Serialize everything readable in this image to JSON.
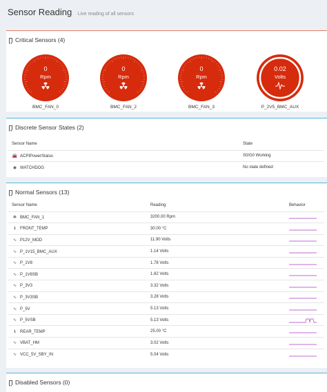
{
  "header": {
    "title": "Sensor Reading",
    "subtitle": "Live reading of all sensors"
  },
  "critical": {
    "heading": "Critical Sensors (4)",
    "gauges": [
      {
        "name": "BMC_FAN_0",
        "value": "0",
        "unit": "Rpm",
        "icon": "radiation-icon",
        "style": "filled"
      },
      {
        "name": "BMC_FAN_2",
        "value": "0",
        "unit": "Rpm",
        "icon": "radiation-icon",
        "style": "filled"
      },
      {
        "name": "BMC_FAN_3",
        "value": "0",
        "unit": "Rpm",
        "icon": "radiation-icon",
        "style": "filled"
      },
      {
        "name": "P_2V5_BMC_AUX",
        "value": "0.02",
        "unit": "Volts",
        "icon": "pulse-icon",
        "style": "ring"
      }
    ],
    "color": "#d62b0c"
  },
  "discrete": {
    "heading": "Discrete Sensor States (2)",
    "columns": [
      "Sensor Name",
      "State"
    ],
    "rows": [
      {
        "icon": "car-icon",
        "name": "ACPIPowerStatus",
        "state": "S0/G0 Working"
      },
      {
        "icon": "eye-icon",
        "name": "WATCHDOG",
        "state": "No state defined"
      }
    ]
  },
  "normal": {
    "heading": "Normal Sensors (13)",
    "columns": [
      "Sensor Name",
      "Reading",
      "Behavior"
    ],
    "rows": [
      {
        "icon": "fan-icon",
        "name": "BMC_FAN_1",
        "reading": "3200.00 Rpm",
        "bump": false
      },
      {
        "icon": "thermometer-icon",
        "name": "FRONT_TEMP",
        "reading": "30.00 °C",
        "bump": false
      },
      {
        "icon": "pulse-icon",
        "name": "P12V_MOD",
        "reading": "11.90 Volts",
        "bump": false
      },
      {
        "icon": "pulse-icon",
        "name": "P_1V15_BMC_AUX",
        "reading": "1.14 Volts",
        "bump": false
      },
      {
        "icon": "pulse-icon",
        "name": "P_1V8",
        "reading": "1.78 Volts",
        "bump": false
      },
      {
        "icon": "pulse-icon",
        "name": "P_1V8SB",
        "reading": "1.82 Volts",
        "bump": false
      },
      {
        "icon": "pulse-icon",
        "name": "P_3V3",
        "reading": "3.32 Volts",
        "bump": false
      },
      {
        "icon": "pulse-icon",
        "name": "P_3V3SB",
        "reading": "3.28 Volts",
        "bump": false
      },
      {
        "icon": "pulse-icon",
        "name": "P_5V",
        "reading": "5.13 Volts",
        "bump": false
      },
      {
        "icon": "pulse-icon",
        "name": "P_5VSB",
        "reading": "5.13 Volts",
        "bump": true
      },
      {
        "icon": "thermometer-icon",
        "name": "REAR_TEMP",
        "reading": "25.00 °C",
        "bump": false
      },
      {
        "icon": "pulse-icon",
        "name": "VBAT_HM",
        "reading": "3.02 Volts",
        "bump": false
      },
      {
        "icon": "pulse-icon",
        "name": "VCC_5V_SBY_IN",
        "reading": "5.04 Volts",
        "bump": false
      }
    ],
    "spark_color": "#c06ad6"
  },
  "disabled": {
    "heading": "Disabled Sensors (0)"
  }
}
